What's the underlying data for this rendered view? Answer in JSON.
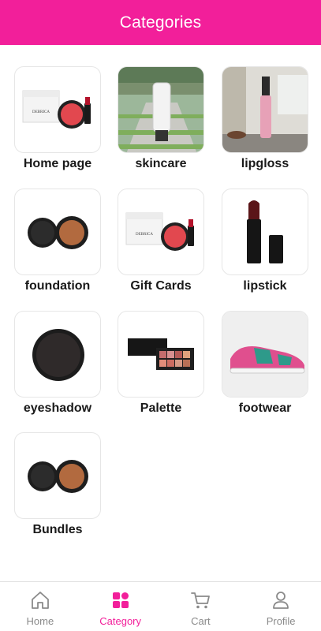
{
  "header": {
    "title": "Categories"
  },
  "categories": [
    {
      "label": "Home page"
    },
    {
      "label": "skincare"
    },
    {
      "label": "lipgloss"
    },
    {
      "label": "foundation"
    },
    {
      "label": "Gift Cards"
    },
    {
      "label": "lipstick"
    },
    {
      "label": "eyeshadow"
    },
    {
      "label": "Palette"
    },
    {
      "label": "footwear"
    },
    {
      "label": "Bundles"
    }
  ],
  "nav": {
    "items": [
      {
        "label": "Home",
        "icon": "home-icon"
      },
      {
        "label": "Category",
        "icon": "grid-icon",
        "active": true
      },
      {
        "label": "Cart",
        "icon": "cart-icon"
      },
      {
        "label": "Profile",
        "icon": "profile-icon"
      }
    ]
  },
  "colors": {
    "accent": "#f21f9a",
    "inactive": "#8a8a8a"
  }
}
